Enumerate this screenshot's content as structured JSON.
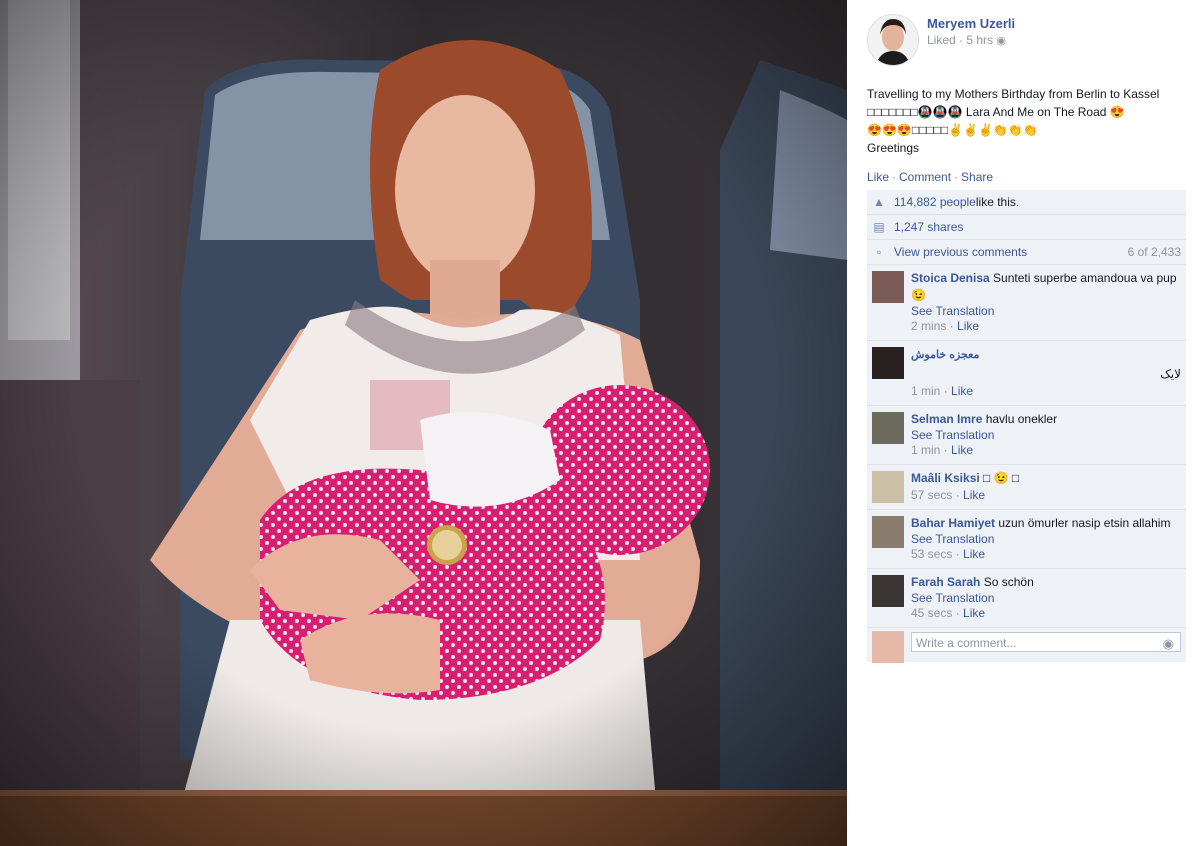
{
  "post": {
    "author": "Meryem Uzerli",
    "meta": "Liked · 5 hrs",
    "text_line1": "Travelling to my Mothers Birthday from Berlin to Kassel",
    "text_line2": "□□□□□□□🚇🚇🚇 Lara And Me on The Road 😍",
    "text_line3": "😍😍😍□□□□□✌✌✌👏👏👏",
    "text_line4": "Greetings"
  },
  "actions": {
    "like": "Like",
    "comment": "Comment",
    "share": "Share"
  },
  "stats": {
    "likes_count": "114,882 people",
    "likes_suffix": " like this.",
    "shares": "1,247 shares",
    "view_previous": "View previous comments",
    "comment_count": "6 of 2,433"
  },
  "comments": [
    {
      "name": "Stoica Denisa",
      "text": " Sunteti superbe amandoua va pup 😉",
      "translate": "See Translation",
      "time": "2 mins",
      "like": "Like"
    },
    {
      "name": "معجزه خاموش",
      "text": "لایک",
      "time": "1 min",
      "like": "Like"
    },
    {
      "name": "Selman Imre",
      "text": " havlu onekler",
      "translate": "See Translation",
      "time": "1 min",
      "like": "Like"
    },
    {
      "name": "Maâli Ksiksi",
      "text": " □ 😉 □",
      "time": "57 secs",
      "like": "Like"
    },
    {
      "name": "Bahar Hamiyet",
      "text": " uzun ömurler nasip etsin allahim",
      "translate": "See Translation",
      "time": "53 secs",
      "like": "Like"
    },
    {
      "name": "Farah Sarah",
      "text": " So schön",
      "translate": "See Translation",
      "time": "45 secs",
      "like": "Like"
    }
  ],
  "write_comment": {
    "placeholder": "Write a comment..."
  },
  "icons": {
    "globe": "globe-icon",
    "thumb": "thumbs-up-icon",
    "share": "share-icon",
    "comment": "comment-icon",
    "camera": "camera-icon"
  },
  "colors": {
    "link": "#3b5998",
    "ufi_bg": "#eef1f6",
    "muted": "#90949c",
    "dots_pink": "#e0287a"
  }
}
